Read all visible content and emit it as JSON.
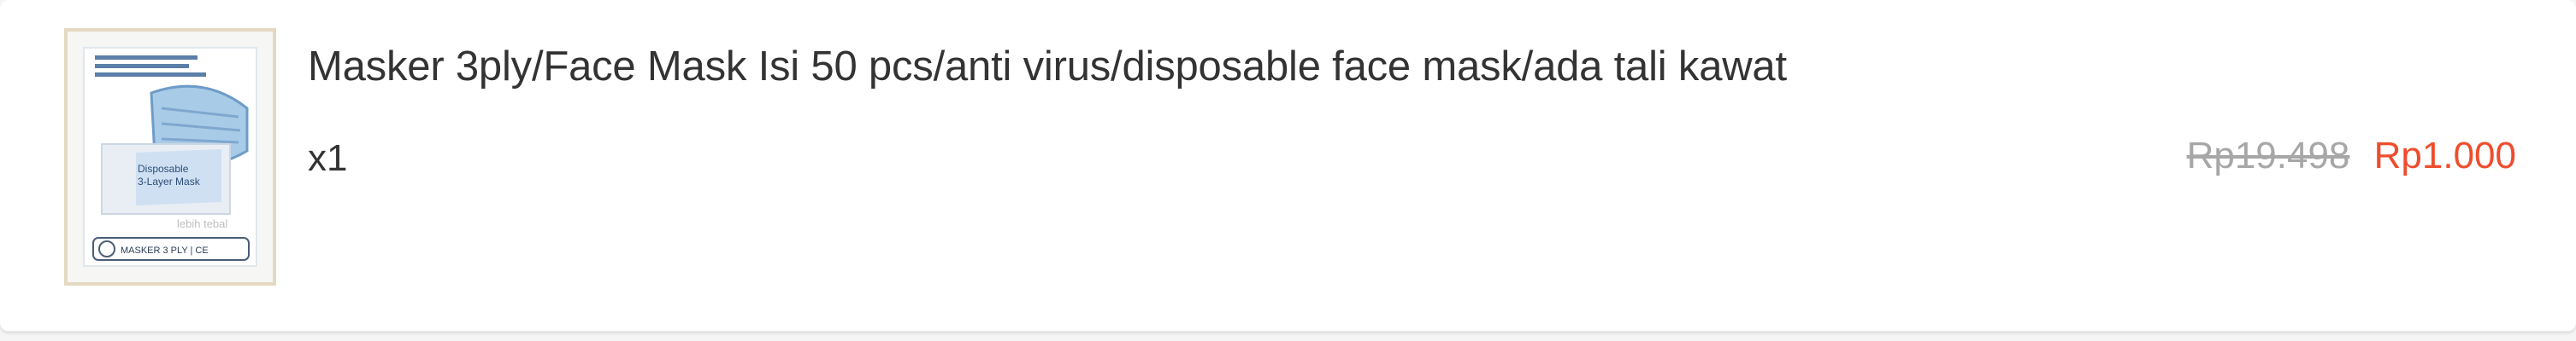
{
  "item": {
    "title": "Masker 3ply/Face Mask Isi 50 pcs/anti virus/disposable face mask/ada tali kawat",
    "quantity": "x1",
    "price_original": "Rp19.498",
    "price_discounted": "Rp1.000"
  },
  "thumbnail": {
    "icon": "product-thumbnail-image",
    "box_text_1": "Disposable",
    "box_text_2": "3-Layer Mask",
    "box_text_3": "lebih tebal",
    "box_text_4": "MASKER 3 PLY | CE"
  },
  "colors": {
    "price_discount": "#ee4d2d",
    "price_original": "#a7a7a7",
    "text": "#333333",
    "card_bg": "#ffffff",
    "page_bg": "#f5f5f5"
  }
}
